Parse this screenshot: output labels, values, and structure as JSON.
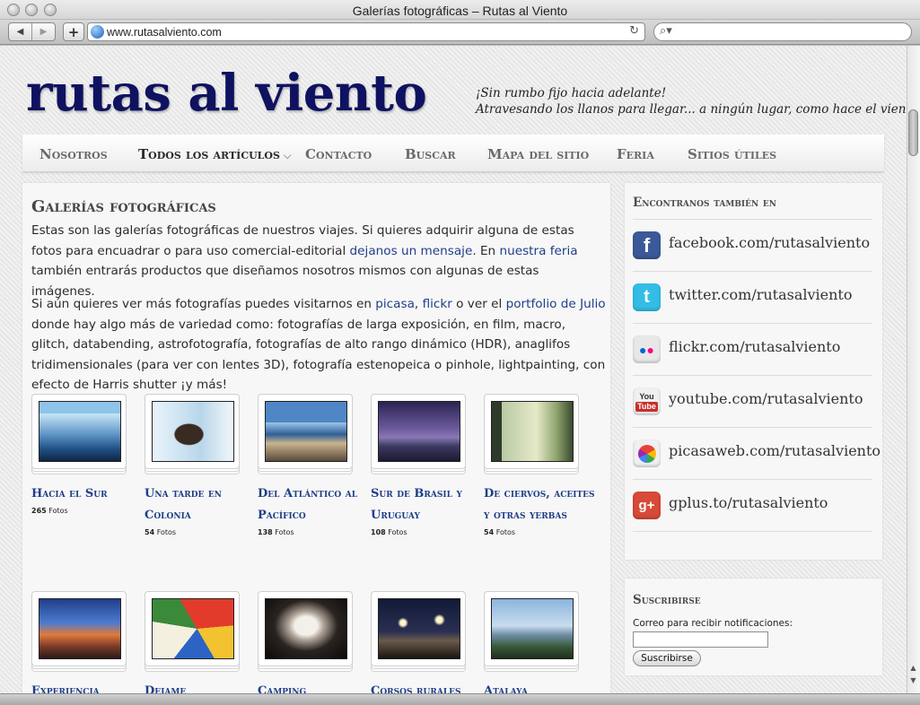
{
  "window": {
    "title": "Galerías fotográficas – Rutas al Viento"
  },
  "toolbar": {
    "url": "www.rutasalviento.com",
    "back_icon": "back-arrow-icon",
    "forward_icon": "forward-arrow-icon",
    "add_icon": "plus-icon",
    "reload_icon": "reload-icon",
    "search_icon": "magnifier-icon"
  },
  "site": {
    "title": "rutas al viento",
    "tagline_1": "¡Sin rumbo fijo hacia adelante!",
    "tagline_2": "Atravesando los llanos para llegar... a ningún lugar, como hace el viento."
  },
  "nav": [
    "Nosotros",
    "Todos los artículos",
    "Contacto",
    "Buscar",
    "Mapa del sitio",
    "Feria",
    "Sitios útiles"
  ],
  "main": {
    "title": "Galerías fotográficas",
    "p1_a": "Estas son las galerías fotográficas de nuestros viajes. Si quieres adquirir alguna de estas fotos para encuadrar o para uso comercial-editorial ",
    "p1_link1": "dejanos un mensaje",
    "p1_b": ". En ",
    "p1_link2": "nuestra feria",
    "p1_c": " también entrarás productos que diseñamos nosotros mismos con algunas de estas imágenes.",
    "p2_a": "Si aún quieres ver más fotografías puedes visitarnos en ",
    "p2_link1": "picasa",
    "p2_sep": ", ",
    "p2_link2": "flickr",
    "p2_b": " o ver el ",
    "p2_link3": "portfolio de Julio",
    "p2_c": " donde hay algo más de variedad como: fotografías de larga exposición, en film, macro, glitch, databending, astrofotografía, fotografías de alto rango dinámico (HDR), anaglifos tridimensionales (para ver con lentes 3D), fotografía estenopeica o pinhole, lightpainting, con efecto de Harris shutter ¡y más!"
  },
  "galleries": [
    {
      "title": "Hacia el Sur",
      "count": "265",
      "unit": "Fotos"
    },
    {
      "title": "Una tarde en Colonia",
      "count": "54",
      "unit": "Fotos"
    },
    {
      "title": "Del Atlántico al Pacífico",
      "count": "138",
      "unit": "Fotos"
    },
    {
      "title": "Sur de Brasil y Uruguay",
      "count": "108",
      "unit": "Fotos"
    },
    {
      "title": "De ciervos, aceites y otras yerbas",
      "count": "54",
      "unit": "Fotos"
    },
    {
      "title": "Experiencia",
      "count": "",
      "unit": ""
    },
    {
      "title": "Dejame",
      "count": "",
      "unit": ""
    },
    {
      "title": "Camping",
      "count": "",
      "unit": ""
    },
    {
      "title": "Corsos rurales",
      "count": "",
      "unit": ""
    },
    {
      "title": "Atalaya",
      "count": "",
      "unit": ""
    }
  ],
  "sidebar": {
    "social_heading": "Encontranos también en",
    "social": [
      {
        "label": "facebook.com/rutasalviento",
        "icon": "facebook-icon",
        "color": "#3b5998"
      },
      {
        "label": "twitter.com/rutasalviento",
        "icon": "twitter-icon",
        "color": "#33bde6"
      },
      {
        "label": "flickr.com/rutasalviento",
        "icon": "flickr-icon",
        "color": "#e8e8e8"
      },
      {
        "label": "youtube.com/rutasalviento",
        "icon": "youtube-icon",
        "color": "#f0f0f0"
      },
      {
        "label": "picasaweb.com/rutasalviento",
        "icon": "picasa-icon",
        "color": "#f0f0f0"
      },
      {
        "label": "gplus.to/rutasalviento",
        "icon": "google-plus-icon",
        "color": "#d84a38"
      }
    ],
    "subscribe_heading": "Suscribirse",
    "subscribe_label": "Correo para recibir notificaciones:",
    "subscribe_value": "",
    "subscribe_button": "Suscribirse"
  },
  "colors": {
    "title": "#0f1260",
    "link": "#1f3e88"
  }
}
